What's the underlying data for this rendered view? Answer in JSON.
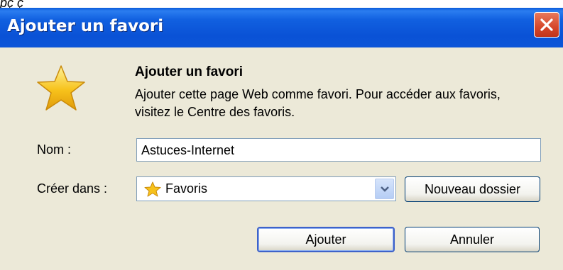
{
  "cropped_text": "pç ç",
  "window": {
    "title": "Ajouter un favori",
    "close_icon": "close-icon"
  },
  "header": {
    "heading": "Ajouter un favori",
    "description": "Ajouter cette page Web comme favori. Pour accéder aux favoris, visitez le Centre des favoris."
  },
  "form": {
    "name_label": "Nom :",
    "name_value": "Astuces-Internet",
    "create_in_label": "Créer dans :",
    "create_in_value": "Favoris",
    "new_folder_label": "Nouveau dossier"
  },
  "actions": {
    "add_label": "Ajouter",
    "cancel_label": "Annuler"
  },
  "colors": {
    "titlebar": "#0a52d6",
    "dialog_bg": "#ece9d8",
    "close_red": "#d6472a",
    "star_gold": "#f7c21b"
  }
}
